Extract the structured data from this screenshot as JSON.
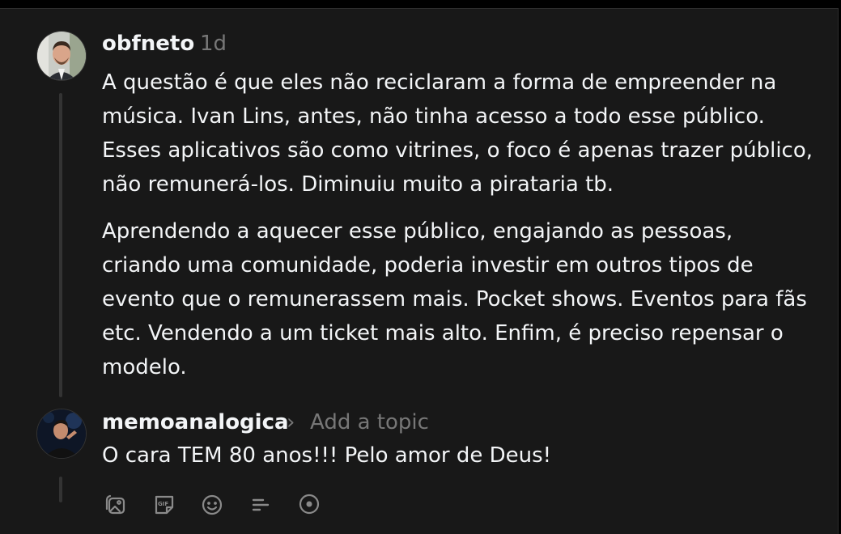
{
  "post": {
    "username": "obfneto",
    "time": "1d",
    "paragraphs": [
      "A questão é que eles não reciclaram a forma de empreender na música. Ivan Lins, antes, não tinha acesso a todo esse público. Esses aplicativos são como vitrines, o foco é apenas trazer público, não remunerá-los. Diminuiu muito a pirataria tb.",
      "Aprendendo a aquecer esse público, engajando as pessoas, criando uma comunidade, poderia investir em outros tipos de evento que o remunerassem mais. Pocket shows. Eventos para fãs etc. Vendendo a um ticket mais alto. Enfim, é preciso repensar o modelo."
    ]
  },
  "reply": {
    "username": "memoanalogica",
    "chevron": "›",
    "topic_placeholder": "Add a topic",
    "text": "O cara TEM 80 anos!!! Pelo amor de Deus!"
  },
  "actions": [
    "image-icon",
    "gif-icon",
    "emoji-icon",
    "poll-icon",
    "location-icon"
  ],
  "colors": {
    "background": "#181818",
    "text": "#f3f5f7",
    "secondary": "#777777",
    "icon": "#8a8a8a"
  }
}
